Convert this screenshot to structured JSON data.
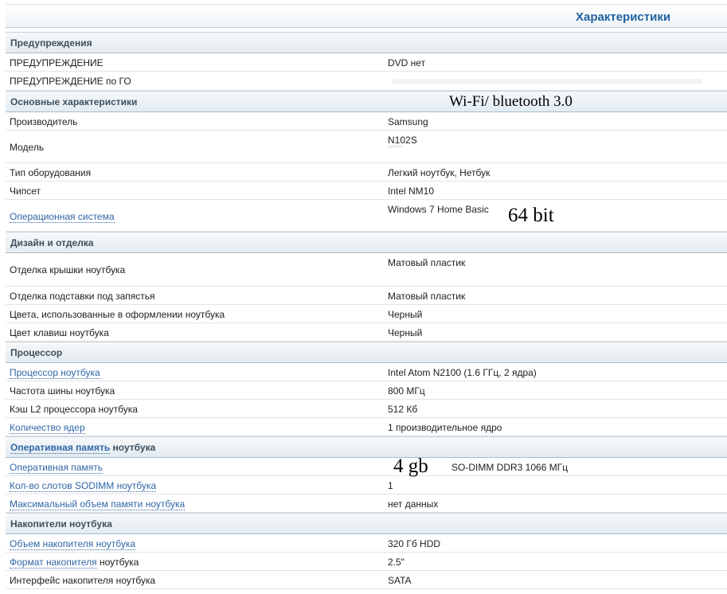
{
  "header": {
    "title": "Характеристики"
  },
  "sections": {
    "warnings": "Предупреждения",
    "main": "Основные характеристики",
    "design": "Дизайн и отделка",
    "cpu": "Процессор",
    "ram": "Оперативная память ноутбука",
    "storage": "Накопители ноутбука"
  },
  "ram_title_parts": {
    "link": "Оперативная память",
    "rest": " ноутбука"
  },
  "rows": {
    "warning": {
      "label": "ПРЕДУПРЕЖДЕНИЕ",
      "value": "DVD нет"
    },
    "warning_go": {
      "label": "ПРЕДУПРЕЖДЕНИЕ по ГО",
      "value": ""
    },
    "manufacturer": {
      "label": "Производитель",
      "value": "Samsung"
    },
    "model": {
      "label": "Модель",
      "value": "N102S"
    },
    "equipment_type": {
      "label": "Тип оборудования",
      "value": "Легкий ноутбук, Нетбук"
    },
    "chipset": {
      "label": "Чипсет",
      "value": "Intel NM10"
    },
    "os": {
      "label": "Операционная система",
      "value": "Windows 7 Home Basic"
    },
    "lid_finish": {
      "label": "Отделка крышки ноутбука",
      "value": "Матовый пластик"
    },
    "palmrest_finish": {
      "label": "Отделка подставки под запястья",
      "value": "Матовый пластик"
    },
    "colors": {
      "label": "Цвета, использованные в оформлении ноутбука",
      "value": "Черный"
    },
    "key_color": {
      "label": "Цвет клавиш ноутбука",
      "value": "Черный"
    },
    "cpu": {
      "label": "Процессор ноутбука",
      "value": "Intel Atom N2100 (1.6 ГГц, 2 ядра)"
    },
    "bus_freq": {
      "label": "Частота шины ноутбука",
      "value": "800 МГц"
    },
    "l2_cache": {
      "label": "Кэш L2 процессора ноутбука",
      "value": "512 Кб"
    },
    "cores": {
      "label": "Количество ядер",
      "value": "1 производительное ядро"
    },
    "ram": {
      "label": "Оперативная память",
      "value": "SO-DIMM DDR3 1066 МГц"
    },
    "sodimm_slots": {
      "label": "Кол-во слотов SODIMM ноутбука",
      "value": "1"
    },
    "max_ram": {
      "label": "Максимальный объем памяти ноутбука",
      "value": "нет данных"
    },
    "storage_size": {
      "label": "Объем накопителя ноутбука",
      "value": "320 Гб HDD"
    },
    "storage_format": {
      "label": "Формат накопителя",
      "label_rest": " ноутбука",
      "value": "2.5\""
    },
    "storage_iface": {
      "label": "Интерфейс накопителя ноутбука",
      "value": "SATA"
    }
  },
  "annotations": {
    "wifi": "Wi-Fi/ bluetooth 3.0",
    "bits": "64 bit",
    "ram_size": "4 gb"
  }
}
